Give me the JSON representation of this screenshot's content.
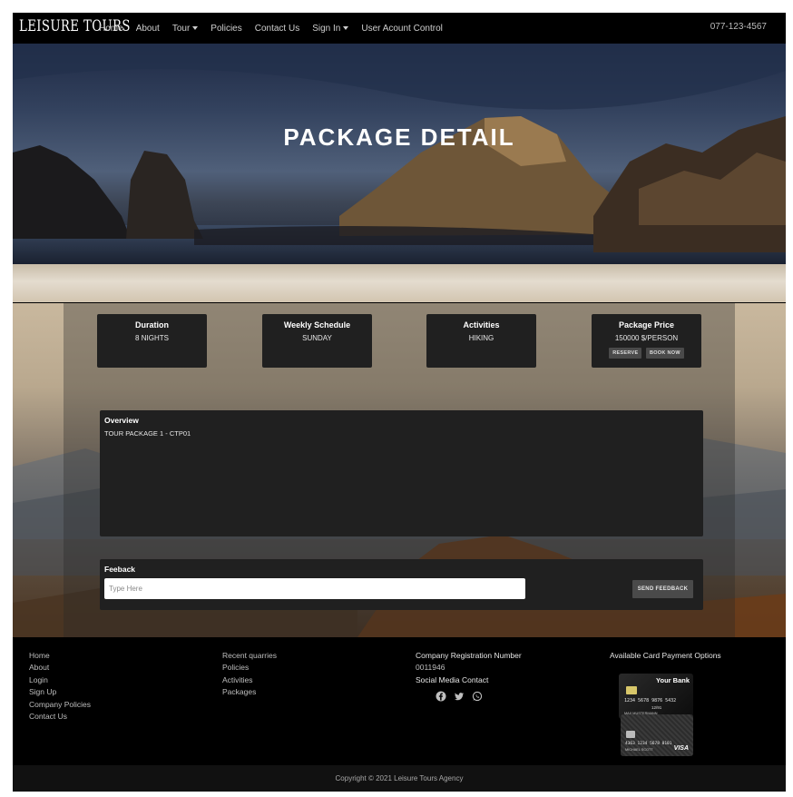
{
  "nav": {
    "brand": "LEISURE TOURS",
    "links": [
      "Home",
      "About",
      "Tour",
      "Policies",
      "Contact Us",
      "Sign In",
      "User Acount Control"
    ],
    "phone": "077-123-4567"
  },
  "hero": {
    "title": "PACKAGE DETAIL"
  },
  "info_cards": [
    {
      "label": "Duration",
      "value": "8 NIGHTS"
    },
    {
      "label": "Weekly Schedule",
      "value": "SUNDAY"
    },
    {
      "label": "Activities",
      "value": "HIKING"
    },
    {
      "label": "Package Price",
      "value": "150000 $/PERSON",
      "reserve_label": "RESERVE",
      "book_label": "BOOK NOW"
    }
  ],
  "overview": {
    "title": "Overview",
    "text": "TOUR PACKAGE 1 - CTP01"
  },
  "feedback": {
    "title": "Feeback",
    "placeholder": "Type Here",
    "button_label": "SEND FEEDBACK"
  },
  "footer": {
    "col1": [
      "Home",
      "About",
      "Login",
      "Sign Up",
      "Company Policies",
      "Contact Us"
    ],
    "col2": [
      "Recent quarries",
      "Policies",
      "Activities",
      "Packages"
    ],
    "registration_label": "Company Registration Number",
    "registration_number": "0011946",
    "social_label": "Social Media Contact",
    "social_icons": [
      "facebook-icon",
      "twitter-icon",
      "whatsapp-icon"
    ],
    "payment_label": "Available Card Payment Options",
    "card1": {
      "bank": "Your Bank",
      "number": "1234 5678 9876 5432",
      "valid": "12/91",
      "name": "MAX MUSTERMANN"
    },
    "card2": {
      "number": "4363 1234 5678 0101",
      "name": "MICHAEL SCOTT",
      "brand": "VISA"
    },
    "copyright": "Copyright © 2021 Leisure Tours Agency"
  }
}
